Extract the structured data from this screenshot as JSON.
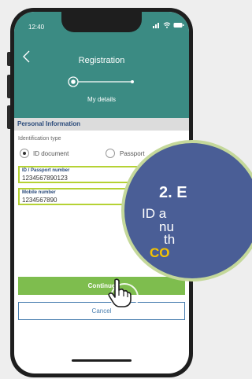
{
  "status_bar": {
    "time": "12:40",
    "icons": [
      "signal-icon",
      "wifi-icon",
      "battery-icon"
    ]
  },
  "header": {
    "title": "Registration",
    "step_label": "My details",
    "back_icon": "chevron-left-icon"
  },
  "section": {
    "title": "Personal Information"
  },
  "identification": {
    "label": "Identification type",
    "options": [
      {
        "label": "ID document",
        "selected": true
      },
      {
        "label": "Passport",
        "selected": false
      }
    ]
  },
  "fields": {
    "id_passport": {
      "label": "ID / Passport number",
      "value": "1234567890123"
    },
    "mobile": {
      "label": "Mobile number",
      "value": "1234567890"
    }
  },
  "buttons": {
    "continue": "Continue",
    "cancel": "Cancel"
  },
  "callout": {
    "heading": "2. E",
    "line1": "ID a",
    "line2": "nu",
    "line3": "th",
    "accent": "CO"
  },
  "colors": {
    "header": "#3b8b83",
    "accent_green": "#7ebd4e",
    "field_border": "#b5d234",
    "callout_bg": "#4a5e96",
    "callout_border": "#c4d89a",
    "callout_accent": "#f5c400",
    "navy": "#2a4a7a"
  }
}
